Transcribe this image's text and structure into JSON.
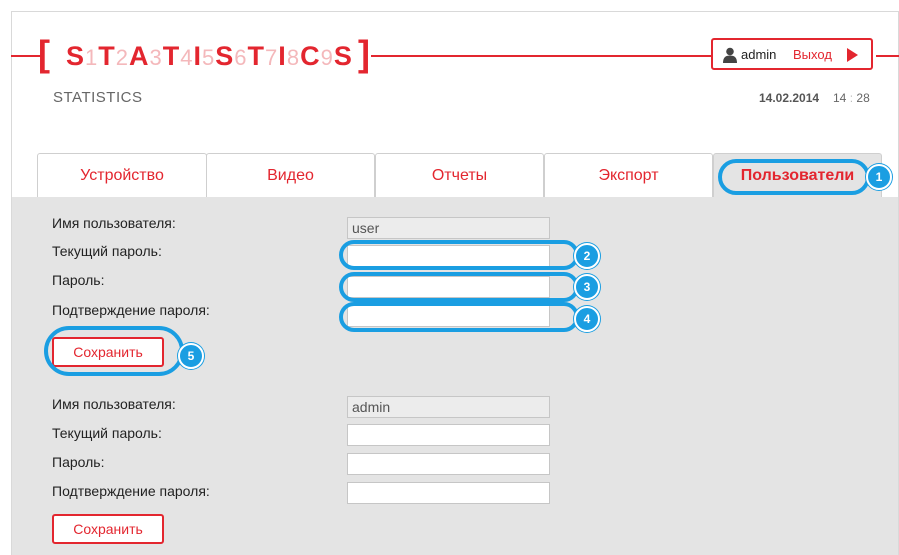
{
  "header": {
    "logo_letters": [
      {
        "ch": "S",
        "dg": "1"
      },
      {
        "ch": "T",
        "dg": "2"
      },
      {
        "ch": "A",
        "dg": "3"
      },
      {
        "ch": "T",
        "dg": "4"
      },
      {
        "ch": "I",
        "dg": "5"
      },
      {
        "ch": "S",
        "dg": "6"
      },
      {
        "ch": "T",
        "dg": "7"
      },
      {
        "ch": "I",
        "dg": "8"
      },
      {
        "ch": "C",
        "dg": "9"
      },
      {
        "ch": "S",
        "dg": ""
      }
    ],
    "subtitle": "STATISTICS",
    "user": "admin",
    "logout": "Выход",
    "date": "14.02.2014",
    "time_h": "14",
    "time_sep": ":",
    "time_m": "28",
    "accent_color": "#e3262f",
    "user_icon": "user-icon",
    "logout_icon": "arrow-right-icon"
  },
  "tabs": [
    {
      "label": "Устройство"
    },
    {
      "label": "Видео"
    },
    {
      "label": "Отчеты"
    },
    {
      "label": "Экспорт"
    },
    {
      "label": "Пользователи",
      "active": true
    }
  ],
  "forms": [
    {
      "labels": {
        "username": "Имя пользователя:",
        "current_password": "Текущий пароль:",
        "password": "Пароль:",
        "confirm": "Подтверждение пароля:"
      },
      "username_value": "user",
      "save": "Сохранить"
    },
    {
      "labels": {
        "username": "Имя пользователя:",
        "current_password": "Текущий пароль:",
        "password": "Пароль:",
        "confirm": "Подтверждение пароля:"
      },
      "username_value": "admin",
      "save": "Сохранить"
    }
  ],
  "callouts": [
    "1",
    "2",
    "3",
    "4",
    "5"
  ],
  "callout_color": "#1a9ee2"
}
